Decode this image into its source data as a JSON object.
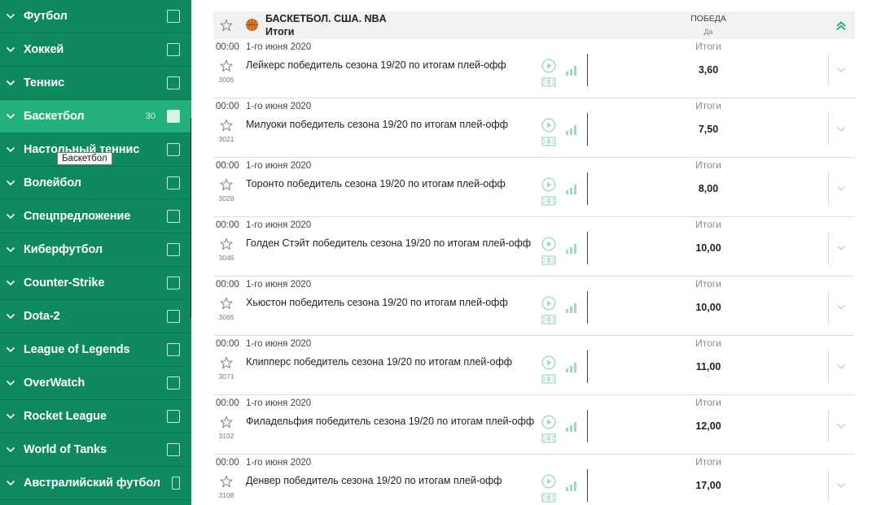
{
  "sidebar": {
    "items": [
      {
        "label": "Футбол",
        "count": "",
        "active": false
      },
      {
        "label": "Хоккей",
        "count": "",
        "active": false
      },
      {
        "label": "Теннис",
        "count": "",
        "active": false
      },
      {
        "label": "Баскетбол",
        "count": "30",
        "active": true
      },
      {
        "label": "Настольный теннис",
        "count": "",
        "active": false
      },
      {
        "label": "Волейбол",
        "count": "",
        "active": false
      },
      {
        "label": "Спецпредложение",
        "count": "",
        "active": false
      },
      {
        "label": "Киберфутбол",
        "count": "",
        "active": false
      },
      {
        "label": "Counter-Strike",
        "count": "",
        "active": false
      },
      {
        "label": "Dota-2",
        "count": "",
        "active": false
      },
      {
        "label": "League of Legends",
        "count": "",
        "active": false
      },
      {
        "label": "OverWatch",
        "count": "",
        "active": false
      },
      {
        "label": "Rocket League",
        "count": "",
        "active": false
      },
      {
        "label": "World of Tanks",
        "count": "",
        "active": false
      },
      {
        "label": "Австралийский футбол",
        "count": "",
        "active": false
      }
    ],
    "tooltip": "Баскетбол"
  },
  "league": {
    "title": "БАСКЕТБОЛ. США. NBA",
    "subtitle": "Итоги",
    "column_label": "ПОБЕДА",
    "column_sublabel": "Да"
  },
  "events": [
    {
      "time": "00:00",
      "date": "1-го июня 2020",
      "number": "3005",
      "name": "Лейкерс победитель сезона 19/20 по итогам плей-офф",
      "market": "Итоги",
      "odds": "3,60"
    },
    {
      "time": "00:00",
      "date": "1-го июня 2020",
      "number": "3021",
      "name": "Милуоки победитель сезона 19/20 по итогам плей-офф",
      "market": "Итоги",
      "odds": "7,50"
    },
    {
      "time": "00:00",
      "date": "1-го июня 2020",
      "number": "3028",
      "name": "Торонто победитель сезона 19/20 по итогам плей-офф",
      "market": "Итоги",
      "odds": "8,00"
    },
    {
      "time": "00:00",
      "date": "1-го июня 2020",
      "number": "3046",
      "name": "Голден Стэйт победитель сезона 19/20 по итогам плей-офф",
      "market": "Итоги",
      "odds": "10,00"
    },
    {
      "time": "00:00",
      "date": "1-го июня 2020",
      "number": "3065",
      "name": "Хьюстон победитель сезона 19/20 по итогам плей-офф",
      "market": "Итоги",
      "odds": "10,00"
    },
    {
      "time": "00:00",
      "date": "1-го июня 2020",
      "number": "3071",
      "name": "Клипперс победитель сезона 19/20 по итогам плей-офф",
      "market": "Итоги",
      "odds": "11,00"
    },
    {
      "time": "00:00",
      "date": "1-го июня 2020",
      "number": "3102",
      "name": "Филадельфия победитель сезона 19/20 по итогам плей-офф",
      "market": "Итоги",
      "odds": "12,00"
    },
    {
      "time": "00:00",
      "date": "1-го июня 2020",
      "number": "3108",
      "name": "Денвер победитель сезона 19/20 по итогам плей-офф",
      "market": "Итоги",
      "odds": "17,00"
    }
  ],
  "icons": {
    "star": "star-icon",
    "ball": "basketball-icon",
    "play": "play-icon",
    "stats": "stats-icon",
    "field": "field-icon",
    "chevron": "chevron-down-icon",
    "collapse": "double-chevron-up-icon"
  },
  "colors": {
    "sidebar_bg": "#0f8a5e",
    "sidebar_active": "#23b07c",
    "accent": "#1aa36f",
    "icon_green": "#9fd9c0"
  }
}
